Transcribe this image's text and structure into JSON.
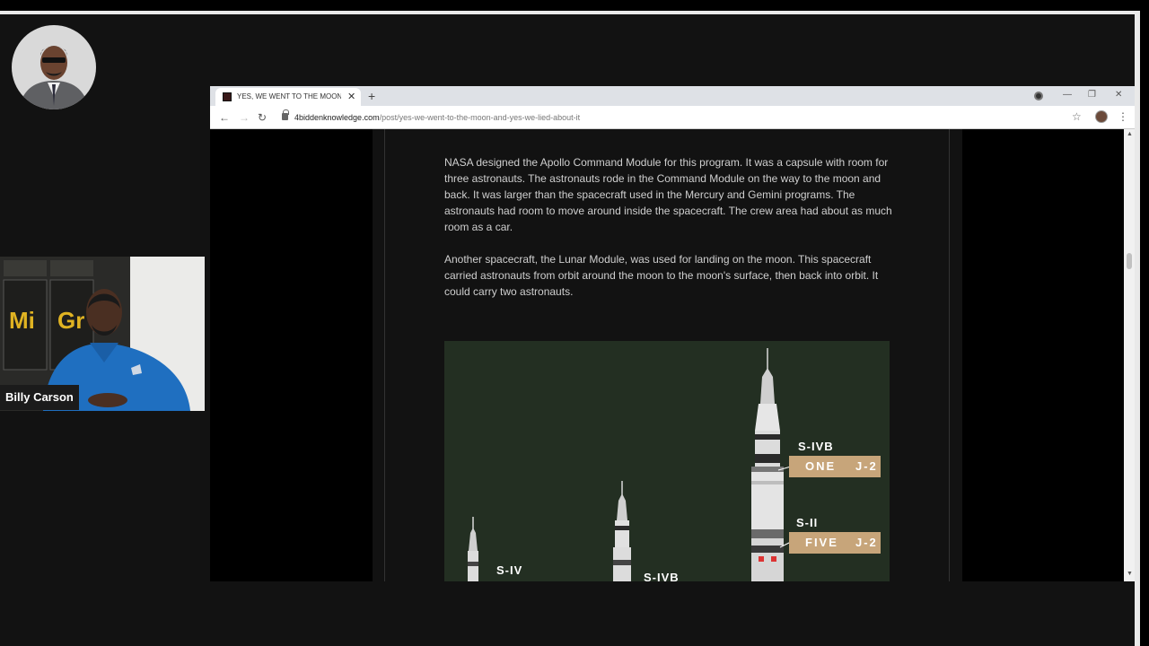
{
  "webcam": {
    "name": "Billy Carson"
  },
  "browser": {
    "tab": {
      "title": "YES, WE WENT TO THE MOON A"
    },
    "new_tab_glyph": "+",
    "url": {
      "domain": "4biddenknowledge.com",
      "path": "/post/yes-we-went-to-the-moon-and-yes-we-lied-about-it"
    }
  },
  "article": {
    "paragraphs": [
      "NASA designed the Apollo Command Module for this program. It was a capsule with room for three astronauts. The astronauts rode in the Command Module on the way to the moon and back. It was larger than the spacecraft used in the Mercury and Gemini programs. The astronauts had room to move around inside the spacecraft. The crew area had about as much room as a car.",
      "Another spacecraft, the Lunar Module, was used for landing on the moon. This spacecraft carried astronauts from orbit around the moon to the moon's surface, then back into orbit. It could carry two astronauts."
    ],
    "figure": {
      "labels": {
        "sivb": "S-IVB",
        "sii": "S-II",
        "siv": "S-IV",
        "sivb_small": "S-IVB"
      },
      "engines": [
        {
          "count": "ONE",
          "engine": "J-2"
        },
        {
          "count": "FIVE",
          "engine": "J-2"
        }
      ]
    }
  },
  "colors": {
    "frame": "#e9e9e9",
    "figure_bg": "#232f22",
    "engine_label": "#c7a57a"
  }
}
